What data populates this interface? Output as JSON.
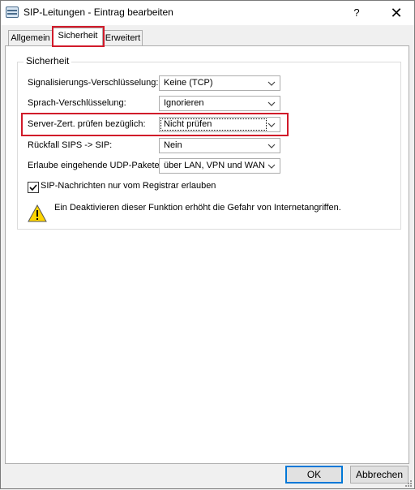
{
  "window": {
    "title": "SIP-Leitungen - Eintrag bearbeiten",
    "help_glyph": "?",
    "close_glyph": "✕"
  },
  "tabs": [
    {
      "label": "Allgemein",
      "active": false
    },
    {
      "label": "Sicherheit",
      "active": true
    },
    {
      "label": "Erweitert",
      "active": false
    }
  ],
  "group": {
    "title": "Sicherheit",
    "rows": [
      {
        "label": "Signalisierungs-Verschlüsselung:",
        "value": "Keine (TCP)"
      },
      {
        "label": "Sprach-Verschlüsselung:",
        "value": "Ignorieren"
      },
      {
        "label": "Server-Zert. prüfen bezüglich:",
        "value": "Nicht prüfen"
      },
      {
        "label": "Rückfall SIPS -> SIP:",
        "value": "Nein"
      },
      {
        "label": "Erlaube eingehende UDP-Pakete:",
        "value": "über LAN, VPN und WAN"
      }
    ],
    "checkbox": {
      "label": "SIP-Nachrichten nur vom Registrar erlauben",
      "checked": true
    },
    "warning": "Ein Deaktivieren dieser Funktion erhöht die Gefahr von Internetangriffen."
  },
  "buttons": {
    "ok": "OK",
    "cancel": "Abbrechen"
  },
  "colors": {
    "highlight": "#d11a2a",
    "default_button_border": "#0078d7",
    "warning_fill": "#ffd400"
  }
}
